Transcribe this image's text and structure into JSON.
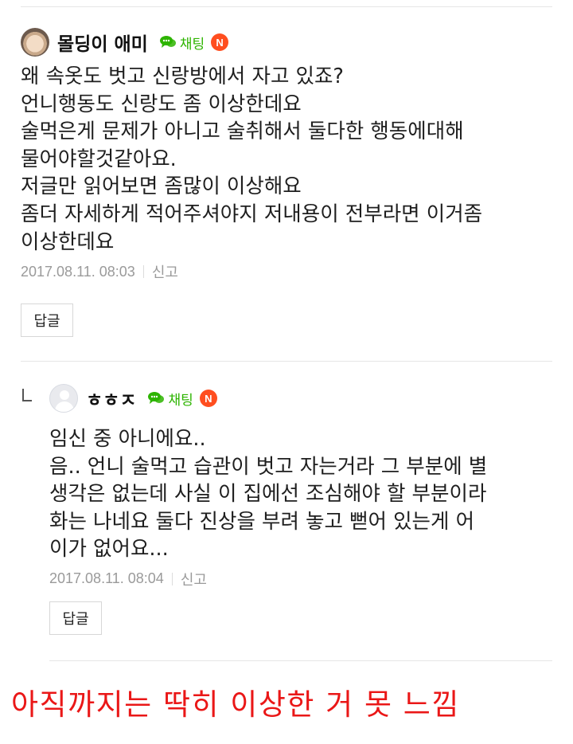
{
  "comments": [
    {
      "nickname": "몰딩이 애미",
      "chat_label": "채팅",
      "badge": "N",
      "body": "왜 속옷도 벗고 신랑방에서 자고 있죠?\n언니행동도 신랑도 좀 이상한데요\n술먹은게 문제가 아니고 술취해서 둘다한 행동에대해\n물어야할것같아요.\n저글만 읽어보면 좀많이 이상해요\n좀더 자세하게 적어주셔야지 저내용이 전부라면 이거좀\n이상한데요",
      "timestamp": "2017.08.11. 08:03",
      "report_label": "신고",
      "reply_label": "답글"
    },
    {
      "nickname": "ㅎㅎㅈ",
      "chat_label": "채팅",
      "badge": "N",
      "body": "임신 중 아니에요..\n음.. 언니 술먹고 습관이 벗고 자는거라 그 부분에 별\n생각은 없는데 사실 이 집에선 조심해야 할 부분이라\n화는 나네요 둘다 진상을 부려 놓고 뻗어 있는게 어\n이가 없어요...",
      "timestamp": "2017.08.11. 08:04",
      "report_label": "신고",
      "reply_label": "답글"
    }
  ],
  "caption": "아직까지는 딱히 이상한 거 못 느낌",
  "colors": {
    "chat_green": "#2db400",
    "badge_orange": "#ff4e1f",
    "caption_red": "#ea1717"
  },
  "icons": {
    "chat": "speech-bubble-icon",
    "reply_indent": "reply-arrow-icon",
    "avatar_default": "default-user-icon"
  }
}
